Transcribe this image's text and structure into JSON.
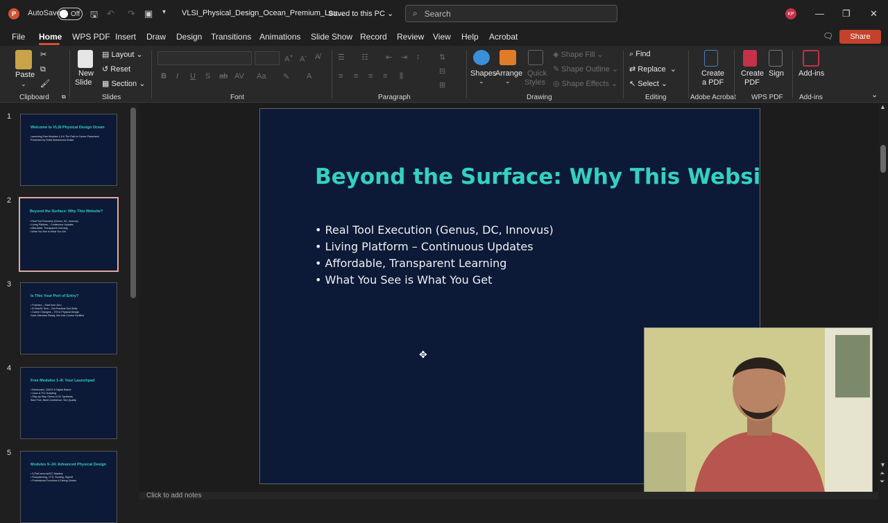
{
  "titlebar": {
    "autosave_label": "AutoSave",
    "autosave_state": "Off",
    "filename": "VLSI_Physical_Design_Ocean_Premium_Lau...",
    "saved_status": "Saved to this PC",
    "search_placeholder": "Search",
    "user_initials": "KP"
  },
  "menu": {
    "items": [
      "File",
      "Home",
      "WPS PDF",
      "Insert",
      "Draw",
      "Design",
      "Transitions",
      "Animations",
      "Slide Show",
      "Record",
      "Review",
      "View",
      "Help",
      "Acrobat"
    ],
    "active": "Home",
    "share_label": "Share"
  },
  "ribbon": {
    "clipboard": {
      "paste": "Paste",
      "label": "Clipboard"
    },
    "slides": {
      "new_slide": "New",
      "new_slide2": "Slide",
      "layout": "Layout",
      "reset": "Reset",
      "section": "Section",
      "label": "Slides"
    },
    "font": {
      "label": "Font"
    },
    "paragraph": {
      "label": "Paragraph"
    },
    "drawing": {
      "shapes": "Shapes",
      "arrange": "Arrange",
      "quick_styles": "Quick",
      "quick_styles2": "Styles",
      "shape_fill": "Shape Fill",
      "shape_outline": "Shape Outline",
      "shape_effects": "Shape Effects",
      "label": "Drawing"
    },
    "editing": {
      "find": "Find",
      "replace": "Replace",
      "select": "Select",
      "label": "Editing"
    },
    "acrobat": {
      "create_pdf": "Create",
      "create_pdf2": "a PDF",
      "label": "Adobe Acrobat"
    },
    "wps": {
      "create_pdf": "Create",
      "create_pdf2": "PDF",
      "sign": "Sign",
      "label": "WPS PDF"
    },
    "addins": {
      "addins": "Add-ins",
      "label": "Add-ins"
    }
  },
  "thumbnails": [
    {
      "num": "1",
      "title": "Welcome to VLSI Physical Design Ocean",
      "lines": [
        "Launching Free Modules 1-8 & The Path to Career Placement",
        "Presented by Sheik Mohammed Khalid"
      ]
    },
    {
      "num": "2",
      "title": "Beyond the Surface: Why This Website?",
      "lines": [
        "• Real Tool Execution (Genus, DC, Innovus)",
        "• Living Platform – Continuous Updates",
        "• Affordable, Transparent Learning",
        "• What You See is What You Get"
      ]
    },
    {
      "num": "3",
      "title": "Is This Your Port of Entry?",
      "lines": [
        "• Freshers – Start from Zero",
        "• B.Tech/M.Tech – Get Practical Tool Skills",
        "• Career Changers – ITS to Physical Design",
        "Goal: Interview Ready, Not Just Course Certified"
      ]
    },
    {
      "num": "4",
      "title": "Free Modules 1–8: Your Launchpad",
      "lines": [
        "• Electronics, CMOS & Digital Basics",
        "• Linux & TCL Scripting",
        "• Step-by-Step Genus & DC Synthesis",
        "Start Free, Build Confidence, See Quality"
      ]
    },
    {
      "num": "5",
      "title": "Modules 9–24: Advanced Physical Design",
      "lines": [
        "• 3-Part Innovus/ICC Mastery",
        "• Floorplanning, CTS, Routing, Signoff",
        "• Professional Functions & Debug Guides"
      ]
    }
  ],
  "slide": {
    "title": "Beyond the Surface: Why This Website?",
    "bullets": [
      "• Real Tool Execution (Genus, DC, Innovus)",
      "• Living Platform – Continuous Updates",
      "• Affordable, Transparent Learning",
      "• What You See is What You Get"
    ]
  },
  "notes_placeholder": "Click to add notes",
  "colors": {
    "accent": "#d35230",
    "slide_bg": "#0c1a38",
    "title_teal": "#33d1c2"
  }
}
